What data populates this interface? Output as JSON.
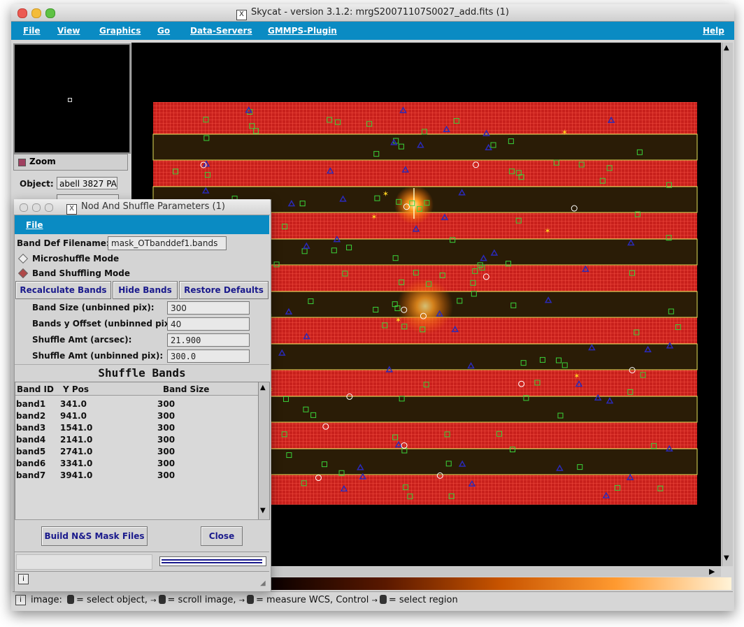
{
  "window": {
    "title": "Skycat - version 3.1.2: mrgS20071107S0027_add.fits (1)"
  },
  "menubar": {
    "file": "File",
    "view": "View",
    "graphics": "Graphics",
    "go": "Go",
    "data_servers": "Data-Servers",
    "gmmps": "GMMPS-Plugin",
    "help": "Help"
  },
  "panel": {
    "zoom_label": "Zoom",
    "object_label": "Object:",
    "object_value": "abell 3827 PA"
  },
  "status": {
    "prefix": "image:",
    "p1": "= select object,",
    "p2": "= scroll image,",
    "p3": "= measure WCS, Control",
    "p4": "= select region"
  },
  "dialog": {
    "title": "Nod And Shuffle Parameters (1)",
    "file_menu": "File",
    "band_def_label": "Band Def Filename:",
    "band_def_value": "mask_OTbanddef1.bands",
    "micro_mode": "Microshuffle Mode",
    "band_mode": "Band Shuffling Mode",
    "btn_recalc": "Recalculate Bands",
    "btn_hide": "Hide Bands",
    "btn_restore": "Restore Defaults",
    "params": [
      {
        "label": "Band Size (unbinned pix):",
        "value": "300"
      },
      {
        "label": "Bands y Offset (unbinned pix):",
        "value": "40"
      },
      {
        "label": "Shuffle Amt (arcsec):",
        "value": "21.900"
      },
      {
        "label": "Shuffle Amt (unbinned pix):",
        "value": "300.0"
      }
    ],
    "section_title": "Shuffle Bands",
    "columns": [
      "Band ID",
      "Y Pos",
      "Band Size"
    ],
    "bands": [
      {
        "id": "band1",
        "y": "341.0",
        "size": "300"
      },
      {
        "id": "band2",
        "y": "941.0",
        "size": "300"
      },
      {
        "id": "band3",
        "y": "1541.0",
        "size": "300"
      },
      {
        "id": "band4",
        "y": "2141.0",
        "size": "300"
      },
      {
        "id": "band5",
        "y": "2741.0",
        "size": "300"
      },
      {
        "id": "band6",
        "y": "3341.0",
        "size": "300"
      },
      {
        "id": "band7",
        "y": "3941.0",
        "size": "300"
      }
    ],
    "btn_build": "Build N&S Mask Files",
    "btn_close": "Close"
  },
  "colors": {
    "menubar": "#0a8bc3",
    "band_red": "#c8201c",
    "band_dark": "#2a1c06",
    "band_outline": "#e6e25a",
    "marker_green": "#3ad23a",
    "marker_blue": "#2a2ab8"
  }
}
